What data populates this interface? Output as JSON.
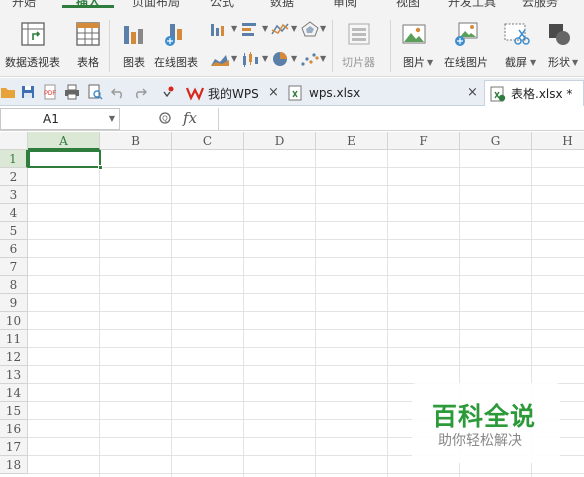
{
  "menubar": {
    "items": [
      {
        "label": "开始"
      },
      {
        "label": "插入"
      },
      {
        "label": "页面布局"
      },
      {
        "label": "公式"
      },
      {
        "label": "数据"
      },
      {
        "label": "审阅"
      },
      {
        "label": "视图"
      },
      {
        "label": "开发工具"
      },
      {
        "label": "云服务"
      }
    ],
    "active_index": 1
  },
  "ribbon": {
    "pivot_table": "数据透视表",
    "table": "表格",
    "chart": "图表",
    "online_chart": "在线图表",
    "slicer": "切片器",
    "picture": "图片",
    "online_picture": "在线图片",
    "screenshot": "截屏",
    "shapes": "形状"
  },
  "tabs": [
    {
      "label": "我的WPS"
    },
    {
      "label": "wps.xlsx"
    },
    {
      "label": "表格.xlsx *"
    }
  ],
  "formula_bar": {
    "name_box": "A1",
    "fx_label": "fx"
  },
  "sheet": {
    "columns": [
      "A",
      "B",
      "C",
      "D",
      "E",
      "F",
      "G",
      "H"
    ],
    "rows": [
      "1",
      "2",
      "3",
      "4",
      "5",
      "6",
      "7",
      "8",
      "9",
      "10",
      "11",
      "12",
      "13",
      "14",
      "15",
      "16",
      "17",
      "18"
    ],
    "selected_cell": "A1"
  },
  "watermark": {
    "title": "百科全说",
    "subtitle": "助你轻松解决"
  },
  "colors": {
    "accent": "#2f7d3c",
    "watermark_green": "#2d9a3a",
    "wps_red": "#d9261c"
  }
}
